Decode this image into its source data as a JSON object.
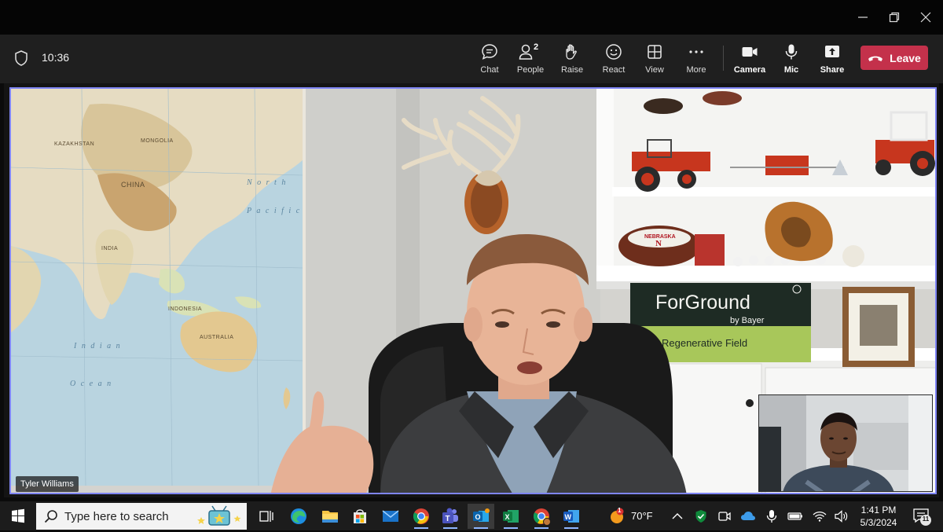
{
  "window": {
    "controls": [
      "minimize-icon",
      "restore-icon",
      "close-icon"
    ]
  },
  "toolbar": {
    "time": "10:36",
    "buttons": {
      "chat": "Chat",
      "people": "People",
      "people_count": "2",
      "raise": "Raise",
      "react": "React",
      "view": "View",
      "more": "More",
      "camera": "Camera",
      "mic": "Mic",
      "share": "Share"
    },
    "leave_label": "Leave",
    "leave_color": "#c4314b",
    "accent_color": "#7f85f5"
  },
  "video": {
    "participant_name": "Tyler Williams",
    "sign_brand": "ForGround",
    "sign_sub": "by Bayer",
    "sign_tagline": "Regenerative Field",
    "map_labels": {
      "kazakhstan": "KAZAKHSTAN",
      "mongolia": "MONGOLIA",
      "china": "CHINA",
      "india": "INDIA",
      "indonesia": "INDONESIA",
      "australia": "AUSTRALIA",
      "indian_ocean": "I n d i a n",
      "ocean": "O c e a n",
      "north_pacific": "N o r t h",
      "pacific": "P a c i f i c"
    },
    "football_label": "NEBRASKA"
  },
  "taskbar": {
    "search_placeholder": "Type here to search",
    "weather": "70°F",
    "weather_badge": "1",
    "time": "1:41 PM",
    "date": "5/3/2024",
    "notification_count": "11",
    "apps": [
      "task-view-icon",
      "edge-icon",
      "file-explorer-icon",
      "store-icon",
      "mail-icon",
      "chrome-icon",
      "teams-icon",
      "outlook-icon",
      "excel-icon",
      "chrome-profile-icon",
      "word-icon"
    ]
  }
}
